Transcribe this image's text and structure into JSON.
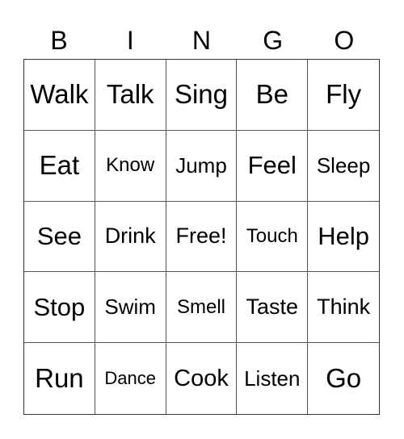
{
  "header": [
    "B",
    "I",
    "N",
    "G",
    "O"
  ],
  "rows": [
    [
      "Walk",
      "Talk",
      "Sing",
      "Be",
      "Fly"
    ],
    [
      "Eat",
      "Know",
      "Jump",
      "Feel",
      "Sleep"
    ],
    [
      "See",
      "Drink",
      "Free!",
      "Touch",
      "Help"
    ],
    [
      "Stop",
      "Swim",
      "Smell",
      "Taste",
      "Think"
    ],
    [
      "Run",
      "Dance",
      "Cook",
      "Listen",
      "Go"
    ]
  ]
}
